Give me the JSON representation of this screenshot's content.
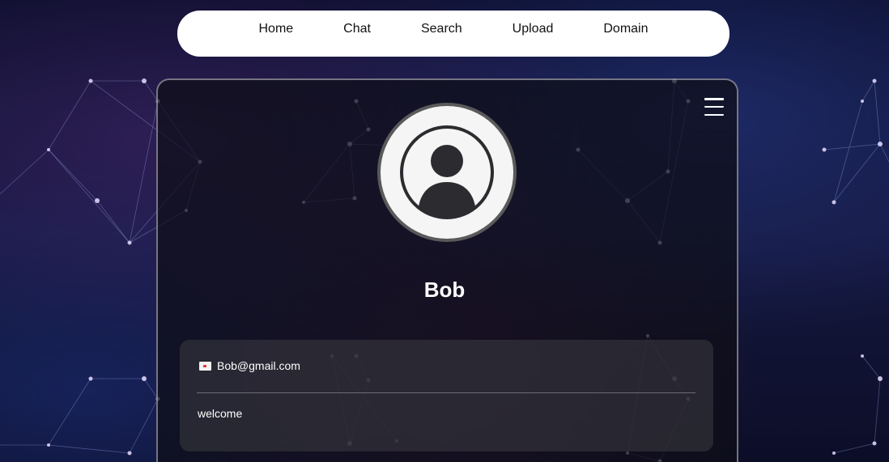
{
  "nav": {
    "items": [
      {
        "label": "Home"
      },
      {
        "label": "Chat"
      },
      {
        "label": "Search"
      },
      {
        "label": "Upload"
      },
      {
        "label": "Domain"
      }
    ]
  },
  "profile": {
    "avatar_icon": "user-avatar-icon",
    "name": "Bob",
    "email": "Bob@gmail.com",
    "email_icon": "envelope-icon",
    "bio": "welcome"
  },
  "menu": {
    "icon": "hamburger-menu-icon"
  },
  "colors": {
    "navbar_bg": "#ffffff",
    "card_bg": "#0e0e16",
    "text": "#ffffff",
    "avatar_border": "#5a5a5a"
  }
}
